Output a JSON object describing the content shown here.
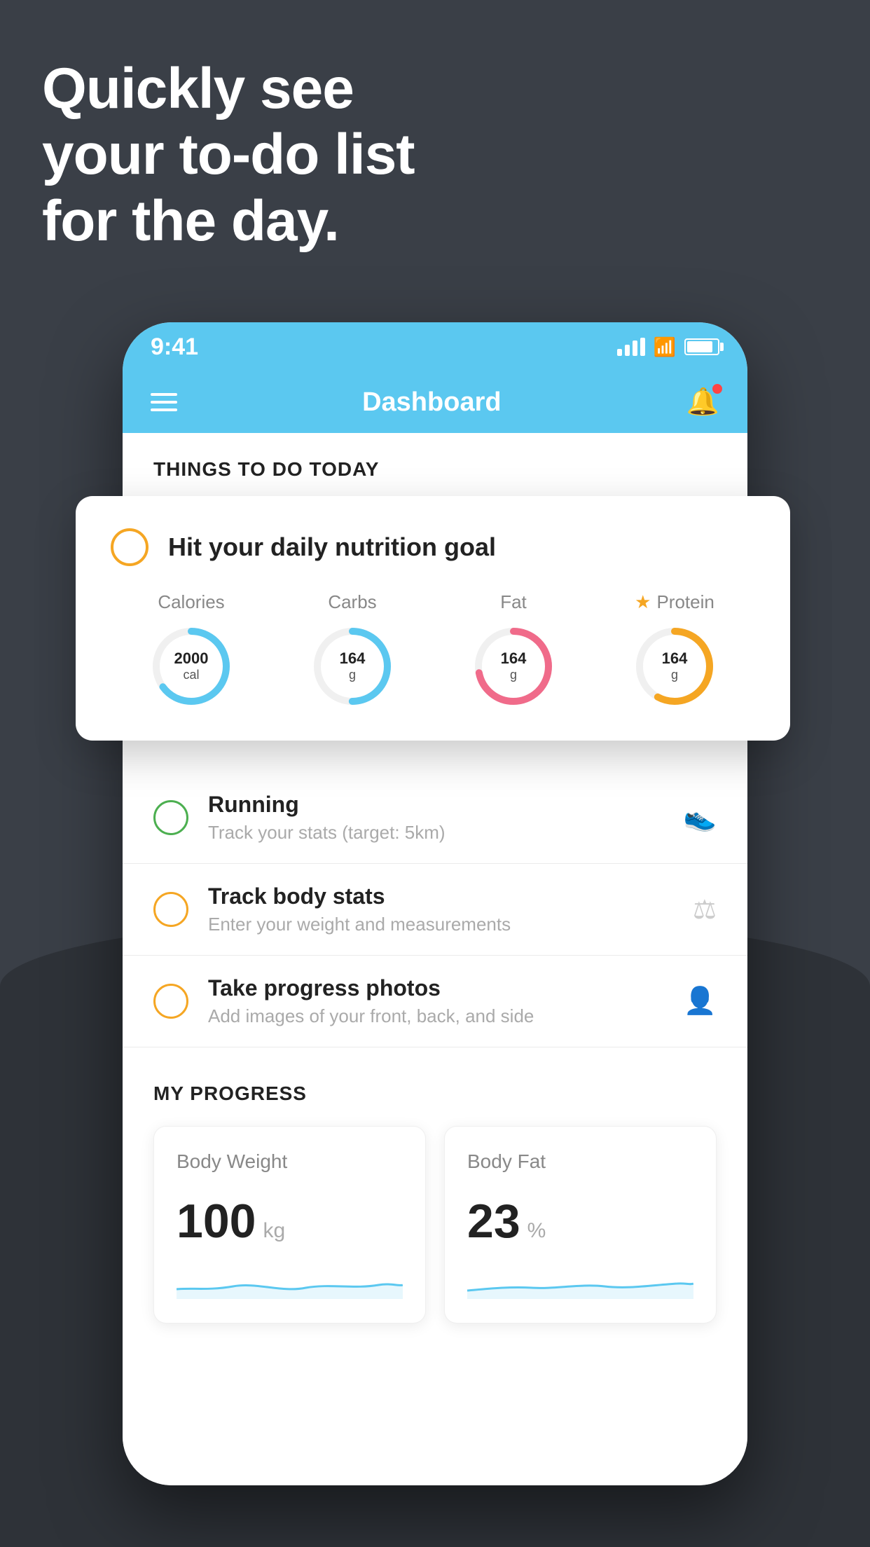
{
  "headline": {
    "line1": "Quickly see",
    "line2": "your to-do list",
    "line3": "for the day."
  },
  "status_bar": {
    "time": "9:41"
  },
  "nav": {
    "title": "Dashboard"
  },
  "things_to_do": {
    "header": "THINGS TO DO TODAY"
  },
  "nutrition_card": {
    "title": "Hit your daily nutrition goal",
    "macros": [
      {
        "label": "Calories",
        "value": "2000",
        "unit": "cal",
        "color": "blue",
        "percent": 65
      },
      {
        "label": "Carbs",
        "value": "164",
        "unit": "g",
        "color": "blue",
        "percent": 50
      },
      {
        "label": "Fat",
        "value": "164",
        "unit": "g",
        "color": "red",
        "percent": 72
      },
      {
        "label": "Protein",
        "value": "164",
        "unit": "g",
        "color": "gold",
        "percent": 58,
        "star": true
      }
    ]
  },
  "todo_items": [
    {
      "title": "Running",
      "sub": "Track your stats (target: 5km)",
      "circle_color": "green",
      "icon": "👟"
    },
    {
      "title": "Track body stats",
      "sub": "Enter your weight and measurements",
      "circle_color": "yellow",
      "icon": "⚖"
    },
    {
      "title": "Take progress photos",
      "sub": "Add images of your front, back, and side",
      "circle_color": "yellow",
      "icon": "👤"
    }
  ],
  "progress": {
    "header": "MY PROGRESS",
    "cards": [
      {
        "title": "Body Weight",
        "value": "100",
        "unit": "kg"
      },
      {
        "title": "Body Fat",
        "value": "23",
        "unit": "%"
      }
    ]
  }
}
